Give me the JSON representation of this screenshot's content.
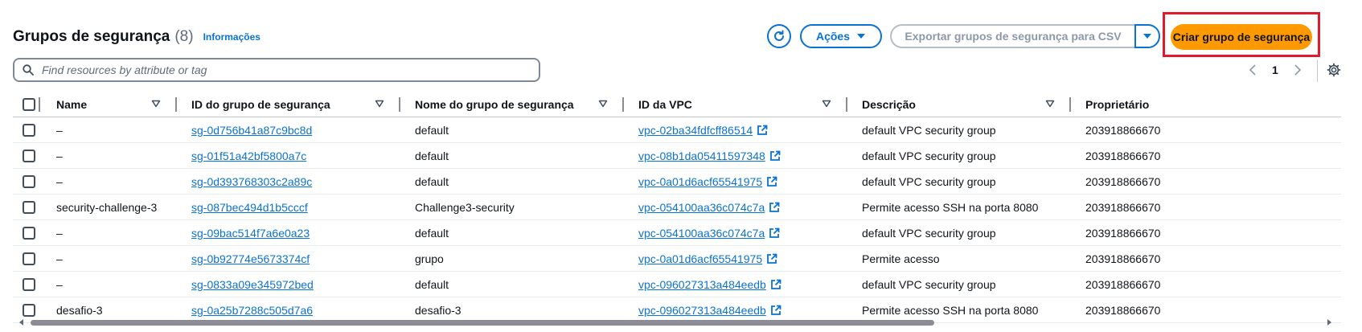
{
  "header": {
    "title": "Grupos de segurança",
    "count": "(8)",
    "info_link": "Informações"
  },
  "actions": {
    "acoes_label": "Ações",
    "export_label": "Exportar grupos de segurança para CSV",
    "create_label": "Criar grupo de segurança"
  },
  "search": {
    "placeholder": "Find resources by attribute or tag"
  },
  "pagination": {
    "current_page": "1"
  },
  "columns": [
    "Name",
    "ID do grupo de segurança",
    "Nome do grupo de segurança",
    "ID da VPC",
    "Descrição",
    "Proprietário"
  ],
  "rows": [
    {
      "name": "–",
      "sg_id": "sg-0d756b41a87c9bc8d",
      "sg_name": "default",
      "vpc_id": "vpc-02ba34fdfcff86514",
      "description": "default VPC security group",
      "owner": "203918866670"
    },
    {
      "name": "–",
      "sg_id": "sg-01f51a42bf5800a7c",
      "sg_name": "default",
      "vpc_id": "vpc-08b1da05411597348",
      "description": "default VPC security group",
      "owner": "203918866670"
    },
    {
      "name": "–",
      "sg_id": "sg-0d393768303c2a89c",
      "sg_name": "default",
      "vpc_id": "vpc-0a01d6acf65541975",
      "description": "default VPC security group",
      "owner": "203918866670"
    },
    {
      "name": "security-challenge-3",
      "sg_id": "sg-087bec494d1b5cccf",
      "sg_name": "Challenge3-security",
      "vpc_id": "vpc-054100aa36c074c7a",
      "description": "Permite acesso SSH na porta 8080",
      "owner": "203918866670"
    },
    {
      "name": "–",
      "sg_id": "sg-09bac514f7a6e0a23",
      "sg_name": "default",
      "vpc_id": "vpc-054100aa36c074c7a",
      "description": "default VPC security group",
      "owner": "203918866670"
    },
    {
      "name": "–",
      "sg_id": "sg-0b92774e5673374cf",
      "sg_name": "grupo",
      "vpc_id": "vpc-0a01d6acf65541975",
      "description": "Permite acesso",
      "owner": "203918866670"
    },
    {
      "name": "–",
      "sg_id": "sg-0833a09e345972bed",
      "sg_name": "default",
      "vpc_id": "vpc-096027313a484eedb",
      "description": "default VPC security group",
      "owner": "203918866670"
    },
    {
      "name": "desafio-3",
      "sg_id": "sg-0a25b7288c505d7a6",
      "sg_name": "desafio-3",
      "vpc_id": "vpc-096027313a484eedb",
      "description": "Permite acesso SSH na porta 8080",
      "owner": "203918866670"
    }
  ],
  "colors": {
    "accent": "#0972d3",
    "primary_button": "#ff9900",
    "highlight_box": "#e01b2b"
  }
}
